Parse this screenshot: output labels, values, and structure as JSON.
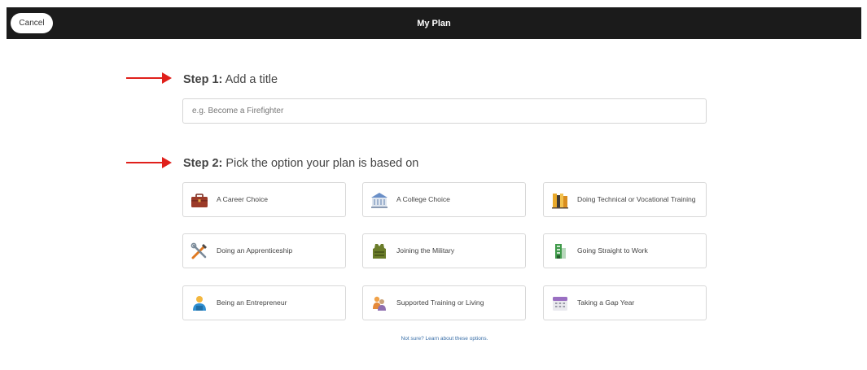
{
  "header": {
    "cancel_label": "Cancel",
    "title": "My Plan"
  },
  "step1": {
    "label": "Step 1:",
    "text": "Add a title",
    "input_placeholder": "e.g. Become a Firefighter",
    "input_value": ""
  },
  "step2": {
    "label": "Step 2:",
    "text": "Pick the option your plan is based on"
  },
  "options": [
    {
      "label": "A Career Choice",
      "icon": "briefcase-icon"
    },
    {
      "label": "A College Choice",
      "icon": "college-building-icon"
    },
    {
      "label": "Doing Technical or Vocational Training",
      "icon": "books-icon"
    },
    {
      "label": "Doing an Apprenticeship",
      "icon": "tools-icon"
    },
    {
      "label": "Joining the Military",
      "icon": "military-vest-icon"
    },
    {
      "label": "Going Straight to Work",
      "icon": "building-door-icon"
    },
    {
      "label": "Being an Entrepreneur",
      "icon": "entrepreneur-person-icon"
    },
    {
      "label": "Supported Training or Living",
      "icon": "supported-people-icon"
    },
    {
      "label": "Taking a Gap Year",
      "icon": "calendar-icon"
    }
  ],
  "learn_link": "Not sure? Learn about these options.",
  "colors": {
    "header_bg": "#1b1b1b",
    "annotation_arrow": "#e0201b",
    "link": "#3a6fa8"
  }
}
